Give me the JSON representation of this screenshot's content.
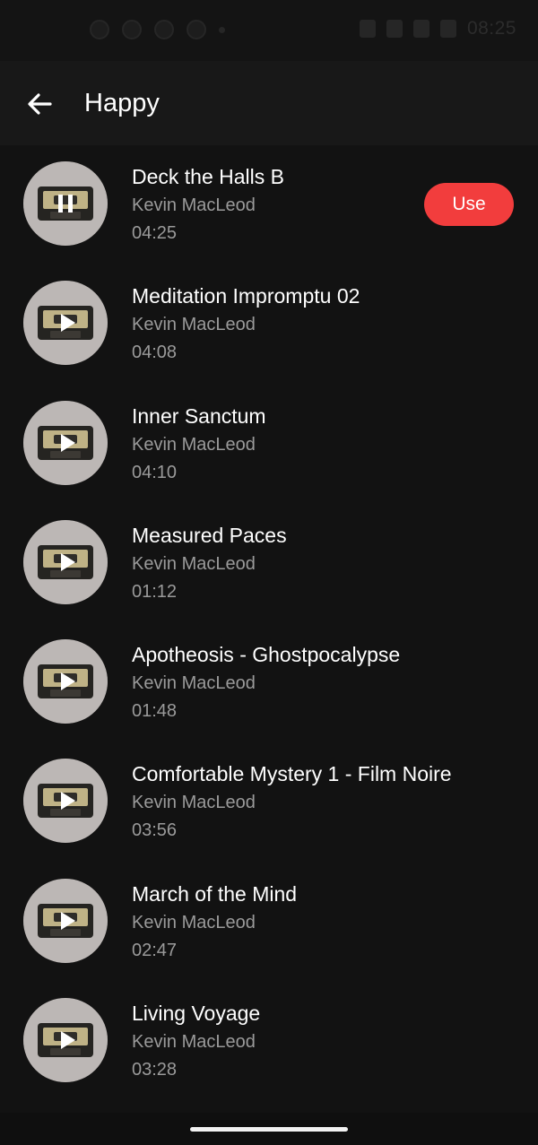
{
  "status_bar": {
    "time": "08:25"
  },
  "header": {
    "back_icon": "arrow-left-icon",
    "title": "Happy"
  },
  "tracks": [
    {
      "title": "Deck the Halls B",
      "artist": "Kevin MacLeod",
      "duration": "04:25",
      "state": "playing"
    },
    {
      "title": "Meditation Impromptu 02",
      "artist": "Kevin MacLeod",
      "duration": "04:08",
      "state": "paused"
    },
    {
      "title": "Inner Sanctum",
      "artist": "Kevin MacLeod",
      "duration": "04:10",
      "state": "paused"
    },
    {
      "title": "Measured Paces",
      "artist": "Kevin MacLeod",
      "duration": "01:12",
      "state": "paused"
    },
    {
      "title": "Apotheosis - Ghostpocalypse",
      "artist": "Kevin MacLeod",
      "duration": "01:48",
      "state": "paused"
    },
    {
      "title": "Comfortable Mystery 1 - Film Noire",
      "artist": "Kevin MacLeod",
      "duration": "03:56",
      "state": "paused"
    },
    {
      "title": "March of the Mind",
      "artist": "Kevin MacLeod",
      "duration": "02:47",
      "state": "paused"
    },
    {
      "title": "Living Voyage",
      "artist": "Kevin MacLeod",
      "duration": "03:28",
      "state": "paused"
    }
  ],
  "use_button": {
    "label": "Use",
    "color": "#f23d3d"
  },
  "colors": {
    "background": "#121212",
    "header": "#181818",
    "secondary_text": "#9a9a9a"
  }
}
